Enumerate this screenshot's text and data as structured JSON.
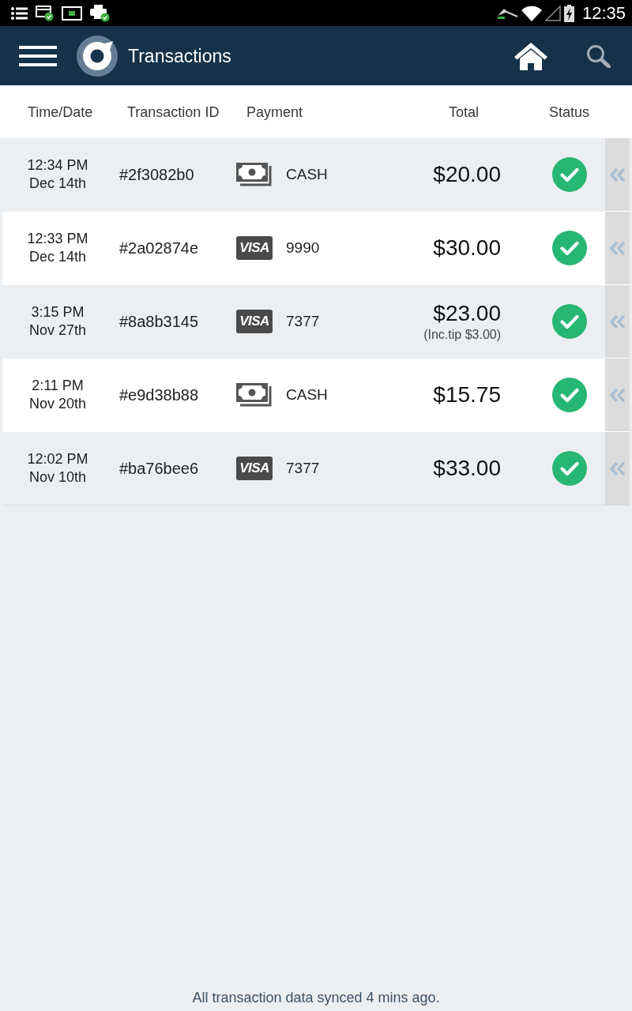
{
  "status_bar": {
    "time": "12:35"
  },
  "app_bar": {
    "title": "Transactions"
  },
  "table": {
    "columns": [
      "Time/Date",
      "Transaction ID",
      "Payment",
      "Total",
      "Status"
    ],
    "rows": [
      {
        "time": "12:34 PM",
        "date": "Dec 14th",
        "transaction_id": "#2f3082b0",
        "payment": {
          "kind": "cash",
          "label": "CASH"
        },
        "total": "$20.00",
        "completed": true
      },
      {
        "time": "12:33 PM",
        "date": "Dec 14th",
        "transaction_id": "#2a02874e",
        "payment": {
          "kind": "card",
          "brand": "VISA",
          "label": "9990"
        },
        "total": "$30.00",
        "completed": true
      },
      {
        "time": "3:15 PM",
        "date": "Nov 27th",
        "transaction_id": "#8a8b3145",
        "payment": {
          "kind": "card",
          "brand": "VISA",
          "label": "7377"
        },
        "total": "$23.00",
        "tip_note": "(Inc.tip $3.00)",
        "completed": true
      },
      {
        "time": "2:11 PM",
        "date": "Nov 20th",
        "transaction_id": "#e9d38b88",
        "payment": {
          "kind": "cash",
          "label": "CASH"
        },
        "total": "$15.75",
        "completed": true
      },
      {
        "time": "12:02 PM",
        "date": "Nov 10th",
        "transaction_id": "#ba76bee6",
        "payment": {
          "kind": "card",
          "brand": "VISA",
          "label": "7377"
        },
        "total": "$33.00",
        "completed": true
      }
    ]
  },
  "footer": {
    "sync_message": "All transaction data synced 4 mins ago."
  }
}
